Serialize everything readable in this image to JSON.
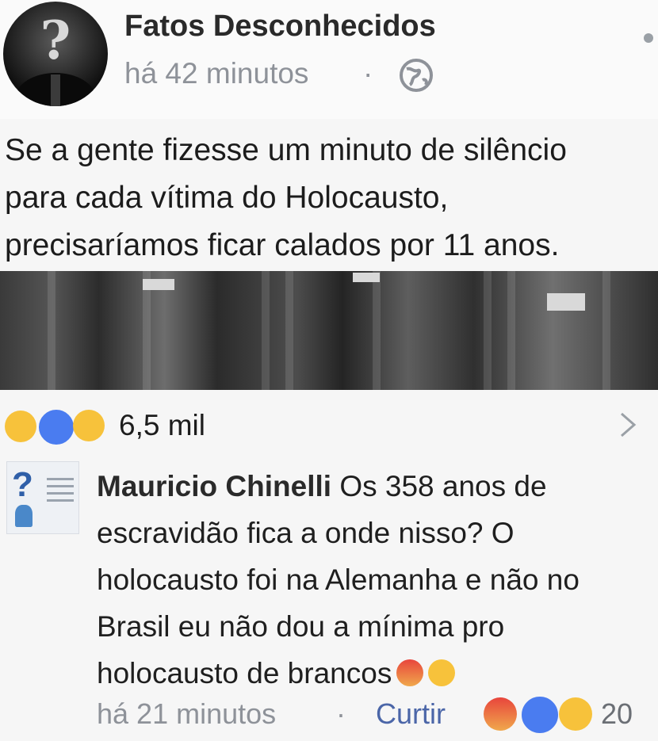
{
  "post": {
    "page_name": "Fatos Desconhecidos",
    "time": "há 42 minutos",
    "separator": "·",
    "privacy_icon": "globe-icon",
    "text_lines": [
      "Se a gente fizesse um minuto de silêncio",
      "para cada vítima do Holocausto,",
      "precisaríamos ficar calados por 11 anos."
    ]
  },
  "reactions": {
    "icons": [
      "sad-reaction-icon",
      "like-reaction-icon",
      "wow-reaction-icon"
    ],
    "count": "6,5 mil"
  },
  "comment": {
    "author": "Mauricio Chinelli",
    "text": "Os 358 anos de escravidão fica a onde nisso? O holocausto foi na Alemanha e não no Brasil eu não dou a mínima pro holocausto de brancos",
    "time": "há 21 minutos",
    "separator": "·",
    "like_label": "Curtir",
    "reaction_icons": [
      "angry-reaction-icon",
      "like-reaction-icon",
      "haha-reaction-icon"
    ],
    "reaction_count": "20"
  },
  "colors": {
    "muted_text": "#8e9299",
    "link_blue": "#4b66a8",
    "like_blue": "#4a7cf0",
    "emoji_yellow": "#f7c23b"
  }
}
